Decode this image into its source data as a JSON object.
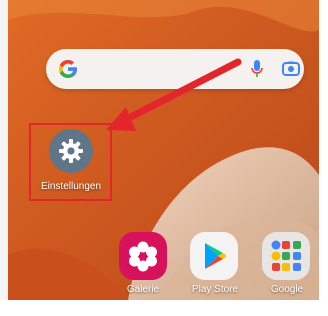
{
  "search": {
    "name": "Google search bar"
  },
  "apps": {
    "settings_label": "Einstellungen",
    "galerie_label": "Galerie",
    "playstore_label": "Play Store",
    "google_label": "Google"
  },
  "icons": [
    "google-logo-icon",
    "mic-icon",
    "google-lens-icon",
    "gear-icon",
    "flower-icon",
    "play-store-icon",
    "google-folder-icon"
  ],
  "colors": {
    "highlight": "#e3262b",
    "arrow": "#e3262b",
    "settings_bg": "#5f7689",
    "galerie_bg": "#d8115d",
    "wallpaper_orange": "#d9561c"
  }
}
